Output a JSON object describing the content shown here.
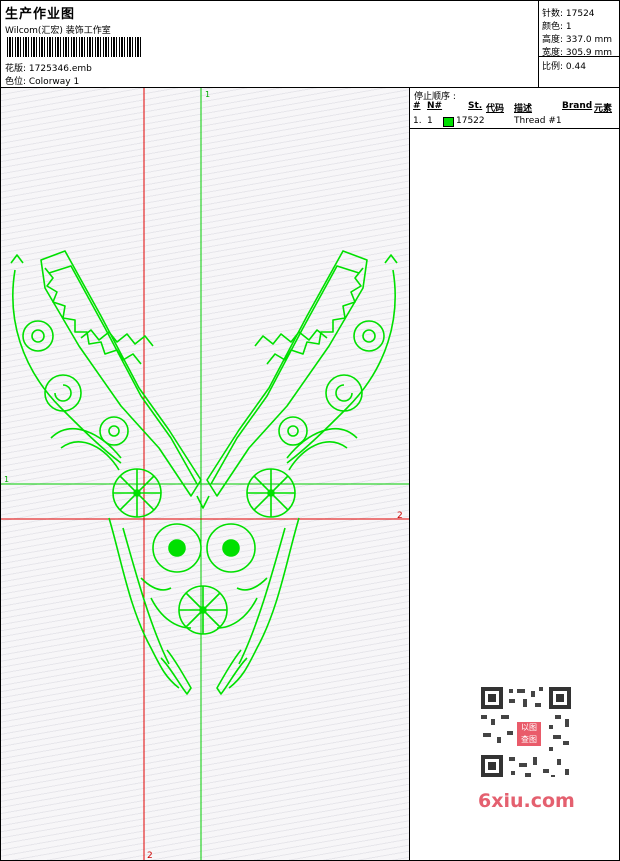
{
  "header": {
    "title": "生产作业图",
    "subtitle": "Wilcom(汇宏) 装饰工作室",
    "design_label": "花版: 1725346.emb",
    "color_label": "色位: Colorway 1"
  },
  "stats": {
    "stitches": "针数: 17524",
    "colors": "颜色: 1",
    "height": "高度: 337.0 mm",
    "width": "宽度: 305.9 mm",
    "ratio": "比例: 0.44"
  },
  "guides": {
    "green_vertical": "1",
    "green_horizontal": "1",
    "red_vertical": "2",
    "red_horizontal": "2"
  },
  "stop_sequence": {
    "title": "停止顺序 :",
    "columns": [
      "#",
      "N#",
      "St.",
      "代码",
      "描述",
      "Brand",
      "元素"
    ],
    "rows": [
      {
        "index": "1.",
        "needle": "1",
        "color": "#00e000",
        "code": "17522",
        "description": "Thread #1"
      }
    ]
  },
  "watermark": {
    "stamp": "以图 查图",
    "site": "6xiu.com"
  },
  "colors": {
    "embroidery": "#00e000",
    "guide_green": "#00cc00",
    "guide_red": "#e00000",
    "watermark": "#e4606f"
  }
}
